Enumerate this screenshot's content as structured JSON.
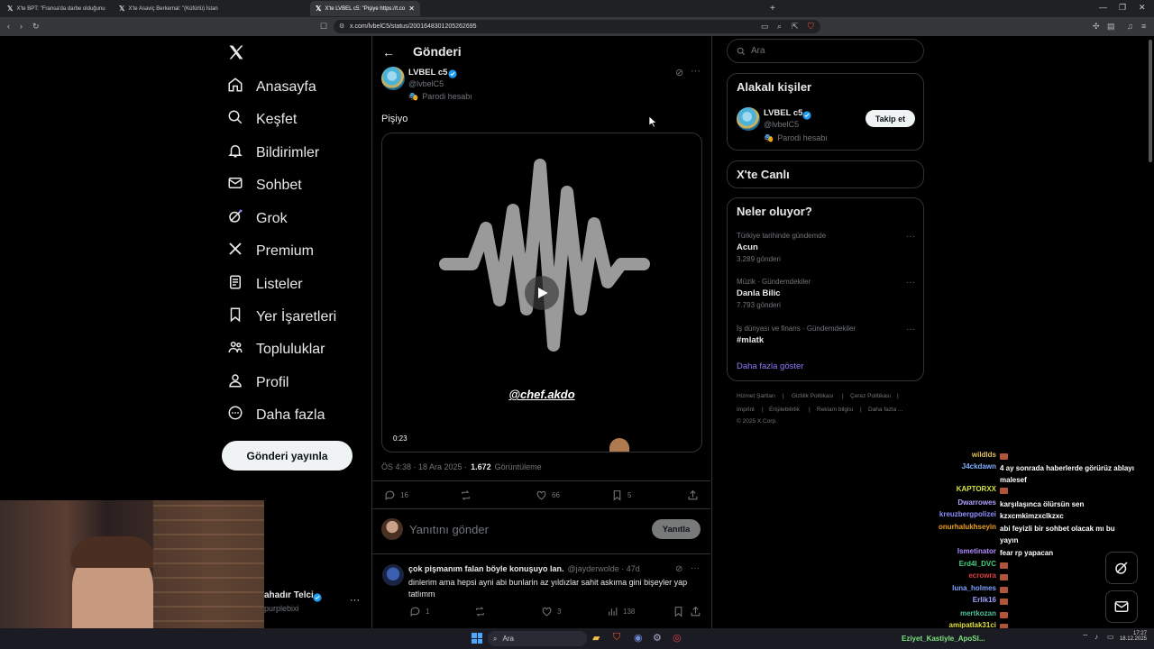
{
  "browser": {
    "tabs": [
      {
        "label": "X'te BPT: \"Fransa'da darbe olduğunu"
      },
      {
        "label": "X'te Asaviç Berkemal: \"(Küfürlü) İstan"
      },
      {
        "label": "X'te LVBEL c5: \"Pişiye https://t.co"
      }
    ],
    "url": "x.com/lvbelC5/status/2001648301205262695"
  },
  "sidebar": {
    "items": [
      {
        "label": "Anasayfa",
        "icon": "home-icon"
      },
      {
        "label": "Keşfet",
        "icon": "search-icon"
      },
      {
        "label": "Bildirimler",
        "icon": "bell-icon"
      },
      {
        "label": "Sohbet",
        "icon": "mail-icon"
      },
      {
        "label": "Grok",
        "icon": "grok-icon"
      },
      {
        "label": "Premium",
        "icon": "x-logo-icon"
      },
      {
        "label": "Listeler",
        "icon": "list-icon"
      },
      {
        "label": "Yer İşaretleri",
        "icon": "bookmark-icon"
      },
      {
        "label": "Topluluklar",
        "icon": "communities-icon"
      },
      {
        "label": "Profil",
        "icon": "profile-icon"
      },
      {
        "label": "Daha fazla",
        "icon": "more-circle-icon"
      }
    ],
    "post_button": "Gönderi yayınla",
    "account": {
      "name": "ahadır Telci",
      "handle": "purplebixi"
    }
  },
  "main": {
    "title": "Gönderi",
    "post": {
      "author": "LVBEL c5",
      "handle": "@lvbelC5",
      "parody": "Parodi hesabı",
      "text": "Pişiyo",
      "video_overlay": "@chef.akdo",
      "video_time": "0:23",
      "timestamp": "ÖS 4:38 · 18 Ara 2025 ·",
      "views_count": "1.672",
      "views_label": "Görüntüleme",
      "stats": {
        "replies": "16",
        "reposts": "",
        "likes": "66",
        "bookmarks": "5"
      }
    },
    "reply_box": {
      "placeholder": "Yanıtını gönder",
      "button": "Yanıtla"
    },
    "reply": {
      "author": "çok pişmanım falan böyle konuşuyo lan.",
      "handle": "@jayderwolde · 47d",
      "text": "dinlerim ama hepsi ayni abi bunlarin az yıldızlar sahit askıma gini bişeyler yap tatlımm",
      "stats": {
        "replies": "1",
        "reposts": "",
        "likes": "3",
        "views": "138"
      }
    }
  },
  "right": {
    "search_placeholder": "Ara",
    "related": {
      "title": "Alakalı kişiler",
      "name": "LVBEL c5",
      "handle": "@lvbelC5",
      "parody": "Parodi hesabı",
      "follow": "Takip et"
    },
    "live": {
      "title": "X'te Canlı"
    },
    "trends": {
      "title": "Neler oluyor?",
      "items": [
        {
          "context": "Türkiye tarihinde gündemde",
          "topic": "Acun",
          "count": "3.289 gönderi"
        },
        {
          "context": "Müzik · Gündemdekiler",
          "topic": "Danla Bilic",
          "count": "7.793 gönderi"
        },
        {
          "context": "İş dünyası ve finans · Gündemdekiler",
          "topic": "#mlatk",
          "count": ""
        }
      ],
      "more": "Daha fazla göster"
    },
    "footer": [
      "Hizmet Şartları",
      "Gizlilik Politikası",
      "Çerez Politikası",
      "Imprint",
      "Erişilebilirlik",
      "Reklam bilgisi",
      "Daha fazla ...",
      "© 2025 X Corp."
    ]
  },
  "chat": [
    {
      "user": "wildlds",
      "msg": "",
      "color": "#e0c060"
    },
    {
      "user": "J4ckdawn",
      "msg": "4 ay sonrada haberlerde görürüz ablayı malesef",
      "color": "#7fb0ff"
    },
    {
      "user": "KAPTORXX",
      "msg": "",
      "color": "#d4e040"
    },
    {
      "user": "Dwarrowes",
      "msg": "karşılaşınca ölürsün sen",
      "color": "#b0a0ff"
    },
    {
      "user": "kreuzbergpolizei",
      "msg": "kzxcmkimzxclkzxc",
      "color": "#8f8fff"
    },
    {
      "user": "onurhalukhseyin",
      "msg": "abi feyizli bir sohbet olacak mı bu yayın",
      "color": "#f0a020"
    },
    {
      "user": "Ismetinator",
      "msg": "fear rp yapacan",
      "color": "#b08cff"
    },
    {
      "user": "Erd4l_DVC",
      "msg": "",
      "color": "#40d080"
    },
    {
      "user": "ecrowra",
      "msg": "",
      "color": "#e04040"
    },
    {
      "user": "luna_holmes",
      "msg": "",
      "color": "#7fa0ff"
    },
    {
      "user": "Erlik16",
      "msg": "",
      "color": "#a0a0ff"
    },
    {
      "user": "mertkozan",
      "msg": "",
      "color": "#50c0a0"
    },
    {
      "user": "amipatlak31ci",
      "msg": "",
      "color": "#e0e040"
    }
  ],
  "taskbar": {
    "search": "Ara",
    "ticker": "Eziyet_Kastiyle_ApoSl...",
    "time": "17:27",
    "date": "18.12.2025"
  },
  "colors": {
    "accent": "#1d9bf0",
    "link": "#8e7cff",
    "background": "#000000"
  }
}
